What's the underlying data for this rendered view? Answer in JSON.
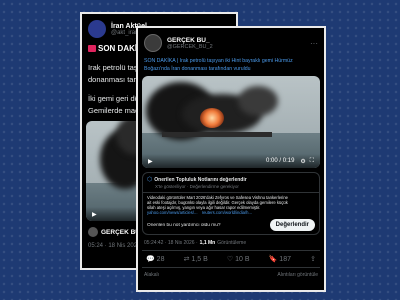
{
  "back_post": {
    "name": "İran Aktüel",
    "handle": "@akt_iran",
    "headline": "SON DAKİKA | I",
    "line1": "Irak petrolü taşıyan",
    "line2": "donanması tarafın",
    "line3": "İki gemi geri dönm",
    "line4": "Gemilerde maddi h",
    "footer_name": "GERÇEK BU_",
    "footer_time": "05:24 · 18 Nis 2026"
  },
  "front_post": {
    "name": "GERÇEK BU_",
    "handle": "@GERCEK_BU_2",
    "text_line1": "SON DAKİKA | Irak petrolü taşıyan iki Hint bayraklı gemi Hürmüz",
    "text_line2": "Boğazı'nda İran donanması tarafından vuruldu",
    "video_time": "0:00 / 0:19",
    "note_title": "Önerilen Topluluk Notlarını değerlendir",
    "note_sub": "X'te gösteriliyor · Değerlendirme gerekiyor",
    "note_line1": "Videodaki görüntüler Mart 2026'daki Zefyros ve Safesea Vishnu tankerlerine",
    "note_line2": "ait eski footajdır, bugünkü olayla ilgili değildir. Gerçek olayda gemilere küçük",
    "note_line3": "silah ateşi açılmış, yangın veya ağır hasar rapor edilmemiştir.",
    "note_link1": "yahoo.com/news/articles/...",
    "note_link2": "reuters.com/world/india/h...",
    "note_question": "Önerilen bu not yardımcı oldu mu?",
    "rate_button": "Değerlendir",
    "time": "05:24:42 · 18 Nis 2026 ·",
    "views": "1,1 Mn",
    "views_label": "Görüntüleme",
    "replies": "28",
    "reposts": "1,5 B",
    "likes": "10 B",
    "bookmarks": "187",
    "bottom_left": "Alakalı",
    "bottom_right": "Alıntıları görüntüle"
  }
}
